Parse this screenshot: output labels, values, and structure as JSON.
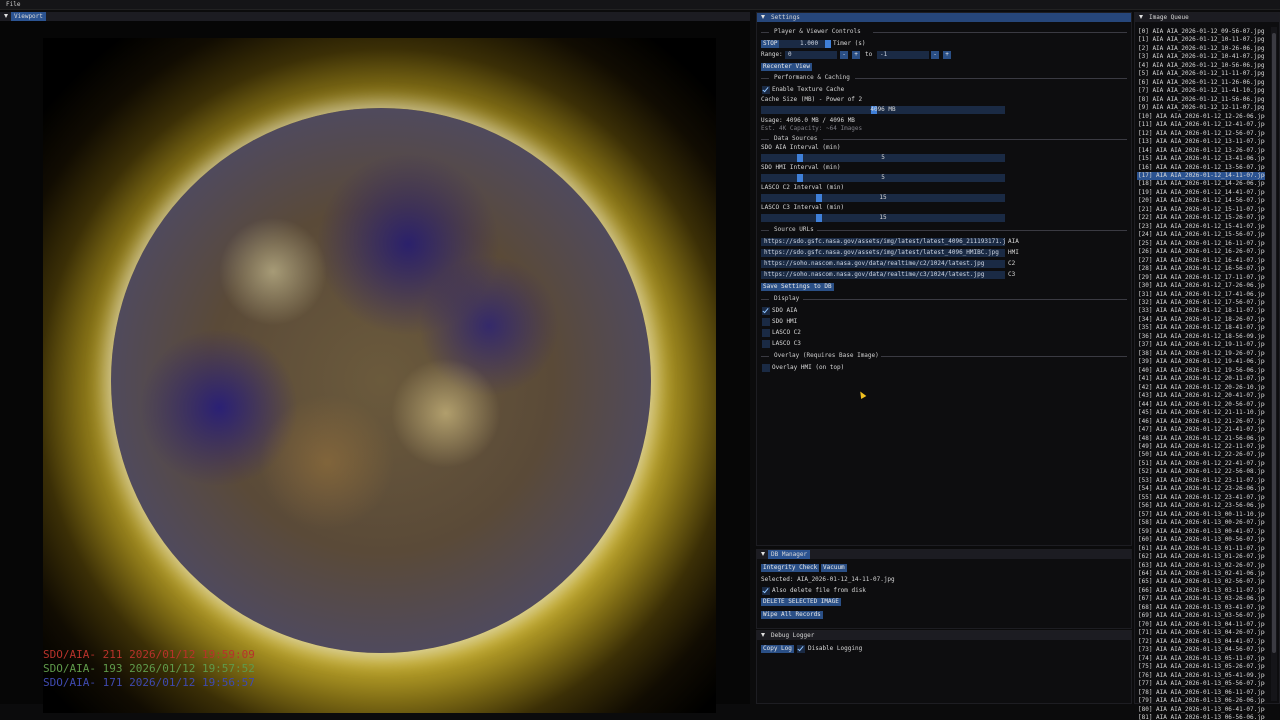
{
  "menubar": {
    "file_label": "File"
  },
  "viewport": {
    "title": "Viewport",
    "legend": [
      {
        "text": "SDO/AIA- 211 2026/01/12 19:59:09",
        "color": "#b8322b"
      },
      {
        "text": "SDO/AIA- 193 2026/01/12 19:57:52",
        "color": "#5f9a4a"
      },
      {
        "text": "SDO/AIA- 171 2026/01/12 19:56:57",
        "color": "#3f4ab0"
      }
    ]
  },
  "settings": {
    "title": "Settings",
    "player_header": "Player & Viewer Controls",
    "stop_label": "STOP",
    "timer_value": "1.000",
    "timer_label": "Timer (s)",
    "range_label": "Range:",
    "range_from": "0",
    "range_to_label": "to",
    "range_to": "-1",
    "minus_label": "-",
    "plus_label": "+",
    "recenter_label": "Recenter View",
    "perf_header": "Performance & Caching",
    "texture_cache_label": "Enable Texture Cache",
    "texture_cache_checked": true,
    "cache_size_label": "Cache Size (MB) - Power of 2",
    "cache_size_value": "4096 MB",
    "usage_text": "Usage: 4096.0 MB / 4096 MB",
    "capacity_text": "Est. 4K Capacity: ~64 Images",
    "data_sources_header": "Data Sources",
    "intervals": [
      {
        "label": "SDO AIA Interval (min)",
        "value": "5",
        "fraction": 0.15
      },
      {
        "label": "SDO HMI Interval (min)",
        "value": "5",
        "fraction": 0.15
      },
      {
        "label": "LASCO C2 Interval (min)",
        "value": "15",
        "fraction": 0.23
      },
      {
        "label": "LASCO C3 Interval (min)",
        "value": "15",
        "fraction": 0.23
      }
    ],
    "source_urls_header": "Source URLs",
    "source_urls": [
      {
        "url": "https://sdo.gsfc.nasa.gov/assets/img/latest/latest_4096_211193171.jpg",
        "tag": "AIA"
      },
      {
        "url": "https://sdo.gsfc.nasa.gov/assets/img/latest/latest_4096_HMIBC.jpg",
        "tag": "HMI"
      },
      {
        "url": "https://soho.nascom.nasa.gov/data/realtime/c2/1024/latest.jpg",
        "tag": "C2"
      },
      {
        "url": "https://soho.nascom.nasa.gov/data/realtime/c3/1024/latest.jpg",
        "tag": "C3"
      }
    ],
    "save_settings_label": "Save Settings to DB",
    "display_header": "Display",
    "display_options": [
      {
        "label": "SDO AIA",
        "checked": true
      },
      {
        "label": "SDO HMI",
        "checked": false
      },
      {
        "label": "LASCO C2",
        "checked": false
      },
      {
        "label": "LASCO C3",
        "checked": false
      }
    ],
    "overlay_header": "Overlay (Requires Base Image)",
    "overlay_label": "Overlay HMI (on top)",
    "overlay_checked": false
  },
  "db_manager": {
    "title": "DB Manager",
    "integrity_label": "Integrity Check",
    "vacuum_label": "Vacuum",
    "selected_text": "Selected: AIA_2026-01-12_14-11-07.jpg",
    "also_delete_label": "Also delete file from disk",
    "also_delete_checked": true,
    "delete_selected_label": "DELETE SELECTED IMAGE",
    "wipe_label": "Wipe All Records"
  },
  "debug_logger": {
    "title": "Debug Logger",
    "copy_log_label": "Copy Log",
    "disable_logging_label": "Disable Logging",
    "disable_logging_checked": true
  },
  "image_queue": {
    "title": "Image Queue",
    "selected_index": 17,
    "items": [
      "[0] AIA AIA_2026-01-12_09-56-07.jpg",
      "[1] AIA AIA_2026-01-12_10-11-07.jpg",
      "[2] AIA AIA_2026-01-12_10-26-06.jpg",
      "[3] AIA AIA_2026-01-12_10-41-07.jpg",
      "[4] AIA AIA_2026-01-12_10-56-06.jpg",
      "[5] AIA AIA_2026-01-12_11-11-07.jpg",
      "[6] AIA AIA_2026-01-12_11-26-06.jpg",
      "[7] AIA AIA_2026-01-12_11-41-10.jpg",
      "[8] AIA AIA_2026-01-12_11-56-06.jpg",
      "[9] AIA AIA_2026-01-12_12-11-07.jpg",
      "[10] AIA AIA_2026-01-12_12-26-06.jpg",
      "[11] AIA AIA_2026-01-12_12-41-07.jpg",
      "[12] AIA AIA_2026-01-12_12-56-07.jpg",
      "[13] AIA AIA_2026-01-12_13-11-07.jpg",
      "[14] AIA AIA_2026-01-12_13-26-07.jpg",
      "[15] AIA AIA_2026-01-12_13-41-06.jpg",
      "[16] AIA AIA_2026-01-12_13-56-07.jpg",
      "[17] AIA AIA_2026-01-12_14-11-07.jpg",
      "[18] AIA AIA_2026-01-12_14-26-06.jpg",
      "[19] AIA AIA_2026-01-12_14-41-07.jpg",
      "[20] AIA AIA_2026-01-12_14-56-07.jpg",
      "[21] AIA AIA_2026-01-12_15-11-07.jpg",
      "[22] AIA AIA_2026-01-12_15-26-07.jpg",
      "[23] AIA AIA_2026-01-12_15-41-07.jpg",
      "[24] AIA AIA_2026-01-12_15-56-07.jpg",
      "[25] AIA AIA_2026-01-12_16-11-07.jpg",
      "[26] AIA AIA_2026-01-12_16-26-07.jpg",
      "[27] AIA AIA_2026-01-12_16-41-07.jpg",
      "[28] AIA AIA_2026-01-12_16-56-07.jpg",
      "[29] AIA AIA_2026-01-12_17-11-07.jpg",
      "[30] AIA AIA_2026-01-12_17-26-06.jpg",
      "[31] AIA AIA_2026-01-12_17-41-06.jpg",
      "[32] AIA AIA_2026-01-12_17-56-07.jpg",
      "[33] AIA AIA_2026-01-12_18-11-07.jpg",
      "[34] AIA AIA_2026-01-12_18-26-07.jpg",
      "[35] AIA AIA_2026-01-12_18-41-07.jpg",
      "[36] AIA AIA_2026-01-12_18-56-09.jpg",
      "[37] AIA AIA_2026-01-12_19-11-07.jpg",
      "[38] AIA AIA_2026-01-12_19-26-07.jpg",
      "[39] AIA AIA_2026-01-12_19-41-06.jpg",
      "[40] AIA AIA_2026-01-12_19-56-06.jpg",
      "[41] AIA AIA_2026-01-12_20-11-07.jpg",
      "[42] AIA AIA_2026-01-12_20-26-10.jpg",
      "[43] AIA AIA_2026-01-12_20-41-07.jpg",
      "[44] AIA AIA_2026-01-12_20-56-07.jpg",
      "[45] AIA AIA_2026-01-12_21-11-10.jpg",
      "[46] AIA AIA_2026-01-12_21-26-07.jpg",
      "[47] AIA AIA_2026-01-12_21-41-07.jpg",
      "[48] AIA AIA_2026-01-12_21-56-06.jpg",
      "[49] AIA AIA_2026-01-12_22-11-07.jpg",
      "[50] AIA AIA_2026-01-12_22-26-07.jpg",
      "[51] AIA AIA_2026-01-12_22-41-07.jpg",
      "[52] AIA AIA_2026-01-12_22-56-08.jpg",
      "[53] AIA AIA_2026-01-12_23-11-07.jpg",
      "[54] AIA AIA_2026-01-12_23-26-06.jpg",
      "[55] AIA AIA_2026-01-12_23-41-07.jpg",
      "[56] AIA AIA_2026-01-12_23-56-06.jpg",
      "[57] AIA AIA_2026-01-13_00-11-10.jpg",
      "[58] AIA AIA_2026-01-13_00-26-07.jpg",
      "[59] AIA AIA_2026-01-13_00-41-07.jpg",
      "[60] AIA AIA_2026-01-13_00-56-07.jpg",
      "[61] AIA AIA_2026-01-13_01-11-07.jpg",
      "[62] AIA AIA_2026-01-13_01-26-07.jpg",
      "[63] AIA AIA_2026-01-13_02-26-07.jpg",
      "[64] AIA AIA_2026-01-13_02-41-06.jpg",
      "[65] AIA AIA_2026-01-13_02-56-07.jpg",
      "[66] AIA AIA_2026-01-13_03-11-07.jpg",
      "[67] AIA AIA_2026-01-13_03-26-06.jpg",
      "[68] AIA AIA_2026-01-13_03-41-07.jpg",
      "[69] AIA AIA_2026-01-13_03-56-07.jpg",
      "[70] AIA AIA_2026-01-13_04-11-07.jpg",
      "[71] AIA AIA_2026-01-13_04-26-07.jpg",
      "[72] AIA AIA_2026-01-13_04-41-07.jpg",
      "[73] AIA AIA_2026-01-13_04-56-07.jpg",
      "[74] AIA AIA_2026-01-13_05-11-07.jpg",
      "[75] AIA AIA_2026-01-13_05-26-07.jpg",
      "[76] AIA AIA_2026-01-13_05-41-09.jpg",
      "[77] AIA AIA_2026-01-13_05-56-07.jpg",
      "[78] AIA AIA_2026-01-13_06-11-07.jpg",
      "[79] AIA AIA_2026-01-13_06-26-06.jpg",
      "[80] AIA AIA_2026-01-13_06-41-07.jpg",
      "[81] AIA AIA_2026-01-13_06-56-06.jpg"
    ]
  }
}
